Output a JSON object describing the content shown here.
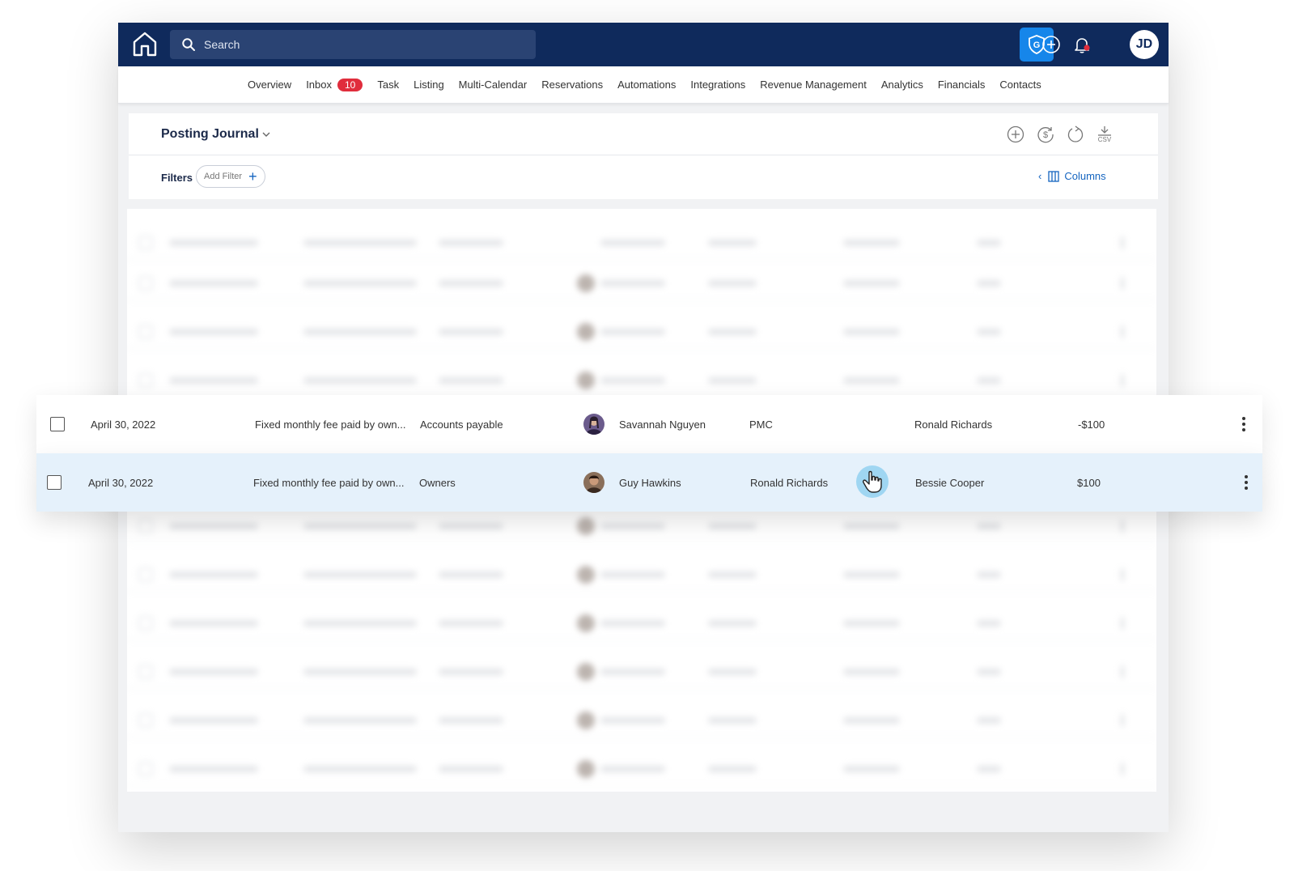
{
  "header": {
    "search_placeholder": "Search",
    "avatar_initials": "JD",
    "shield_icon": "shield-g-icon"
  },
  "nav": {
    "items": [
      {
        "label": "Overview"
      },
      {
        "label": "Inbox",
        "badge": "10"
      },
      {
        "label": "Task"
      },
      {
        "label": "Listing"
      },
      {
        "label": "Multi-Calendar"
      },
      {
        "label": "Reservations"
      },
      {
        "label": "Automations"
      },
      {
        "label": "Integrations"
      },
      {
        "label": "Revenue Management"
      },
      {
        "label": "Analytics"
      },
      {
        "label": "Financials"
      },
      {
        "label": "Contacts"
      }
    ]
  },
  "page": {
    "title": "Posting Journal",
    "filters_label": "Filters",
    "add_filter_label": "Add Filter",
    "columns_label": "Columns",
    "actions": [
      "plus-circle-icon",
      "dollar-refresh-icon",
      "refresh-icon",
      "download-csv-icon"
    ],
    "csv_label": "CSV"
  },
  "rows": [
    {
      "date": "April 30, 2022",
      "description": "Fixed monthly fee paid by own...",
      "account": "Accounts payable",
      "contact": "Savannah Nguyen",
      "from": "PMC",
      "to": "Ronald Richards",
      "amount": "-$100"
    },
    {
      "date": "April 30, 2022",
      "description": "Fixed monthly fee paid by own...",
      "account": "Owners",
      "contact": "Guy Hawkins",
      "from": "Ronald Richards",
      "to": "Bessie Cooper",
      "amount": "$100"
    }
  ],
  "colors": {
    "topbar": "#0f2a5c",
    "accent": "#1686ea",
    "badge": "#e02d3c",
    "highlight_row": "#e5f1fb",
    "link": "#1565c0"
  }
}
